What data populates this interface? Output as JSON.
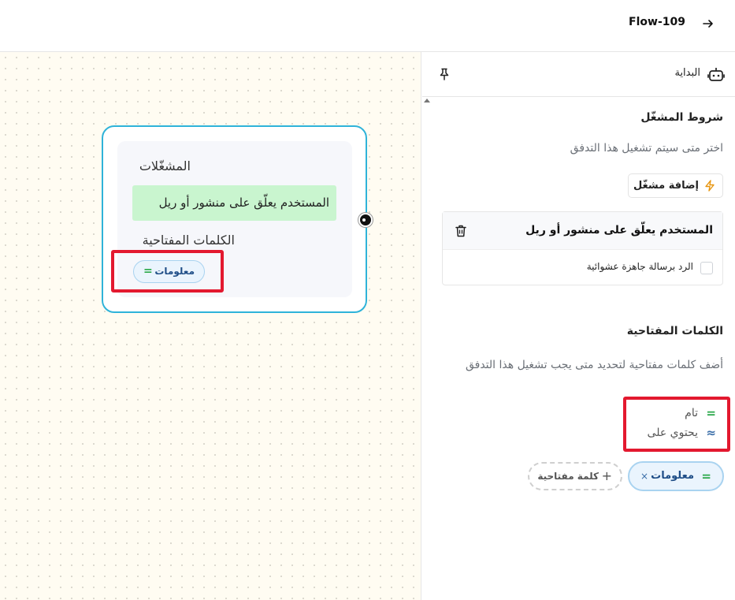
{
  "header": {
    "flow_title": "Flow-109"
  },
  "canvas_node": {
    "triggers_title": "المشغّلات",
    "trigger_label": "المستخدم يعلّق على منشور أو ريل",
    "keywords_title": "الكلمات المفتاحية",
    "keyword_chip": "معلومات",
    "keyword_chip_symbol": "="
  },
  "panel": {
    "start_label": "البداية",
    "trigger_conditions_title": "شروط المشغّل",
    "trigger_conditions_desc": "اختر متى سيتم تشغيل هذا التدفق",
    "add_trigger_label": "إضافة مشغّل",
    "trigger_card": {
      "name": "المستخدم يعلّق على منشور أو ريل",
      "checkbox_label": "الرد برسالة جاهزة عشوائية",
      "checked": false
    },
    "keywords_title": "الكلمات المفتاحية",
    "keywords_desc": "أضف كلمات مفتاحية لتحديد متى يجب تشغيل هذا التدفق",
    "match_types": [
      {
        "symbol": "=",
        "label": "تام"
      },
      {
        "symbol": "≈",
        "label": "يحتوي على"
      }
    ],
    "keyword_chip": {
      "symbol": "=",
      "label": "معلومات",
      "remove": "×"
    },
    "add_keyword_label": "كلمة مفتاحية",
    "add_keyword_symbol": "+"
  },
  "colors": {
    "node_border": "#2fb3d9",
    "trigger_bg": "#c9f5cf",
    "chip_border": "#a9d3f0",
    "highlight": "#e3192f",
    "exact_match": "#2aa84a",
    "contains_match": "#3b6ea8"
  },
  "icons": {
    "back": "arrow-right-icon",
    "bot": "bot-icon",
    "pin": "pin-icon",
    "bolt": "bolt-icon",
    "trash": "trash-icon"
  }
}
